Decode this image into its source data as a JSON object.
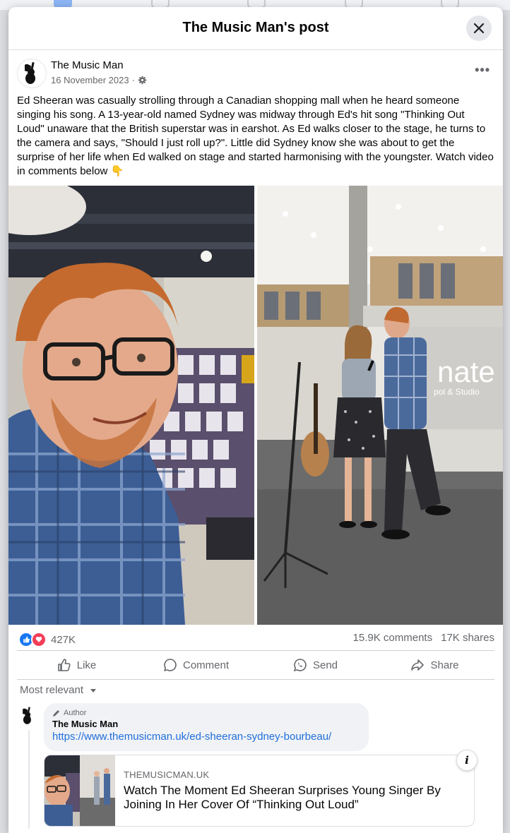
{
  "modal": {
    "title": "The Music Man's post"
  },
  "post": {
    "author": "The Music Man",
    "date": "16 November 2023",
    "date_separator": "·",
    "more_label": "•••",
    "text": "Ed Sheeran was casually strolling through a Canadian shopping mall when he heard someone singing his song. A 13-year-old named Sydney was midway through Ed's hit song \"Thinking Out Loud\" unaware that the British superstar was in earshot. As Ed walks closer to the stage, he turns to the camera and says, \"Should I just roll up?\". Little did Sydney know she was about to get the surprise of her life when Ed walked on stage and started harmonising with the youngster. Watch video in comments below 👇",
    "right_photo_sign_text": "nate",
    "right_photo_sign_sub": "pol & Studio"
  },
  "stats": {
    "reactions": "427K",
    "comments": "15.9K comments",
    "shares": "17K shares"
  },
  "actions": {
    "like": "Like",
    "comment": "Comment",
    "send": "Send",
    "share": "Share"
  },
  "comments_filter": "Most relevant",
  "comment": {
    "badge": "Author",
    "name": "The Music Man",
    "link_text": "https://www.themusicman.uk/ed-sheeran-sydney-bourbeau/",
    "card": {
      "domain": "THEMUSICMAN.UK",
      "title": "Watch The Moment Ed Sheeran Surprises Young Singer By Joining In Her Cover Of “Thinking Out Loud”",
      "info": "i"
    }
  },
  "colors": {
    "link_blue": "#216fdb",
    "like_blue": "#1877f2",
    "love_red": "#f33e58",
    "secondary_text": "#65676b"
  }
}
